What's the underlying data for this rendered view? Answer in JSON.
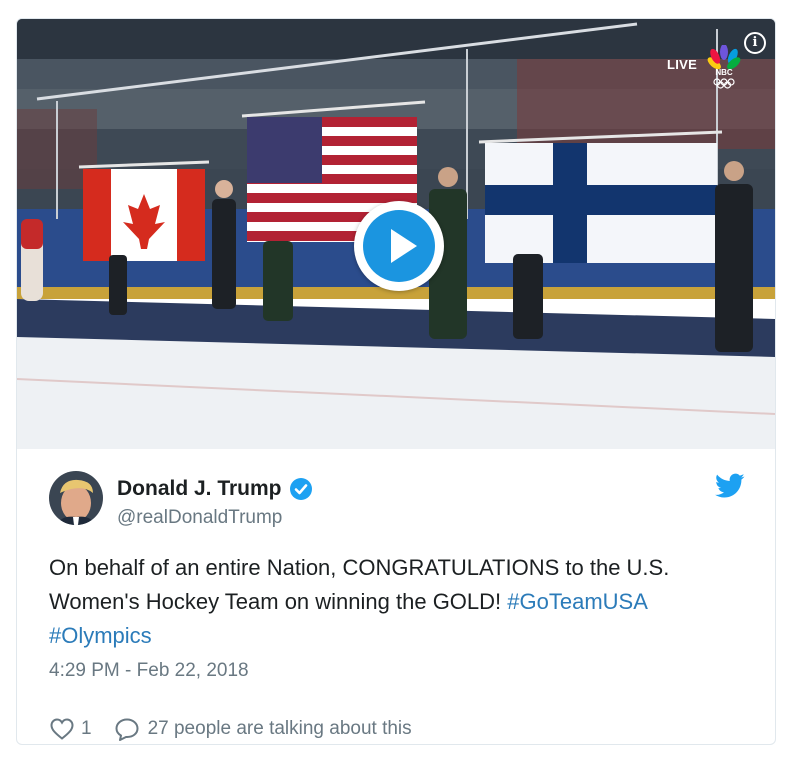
{
  "media": {
    "live_label": "LIVE",
    "network_label": "NBC",
    "info_icon": "info-icon",
    "play_icon": "play-icon",
    "colors": {
      "play": "#1b95e0",
      "ice": "#eef1f4",
      "dasher": "#2b4c8c"
    }
  },
  "tweet": {
    "name": "Donald J. Trump",
    "handle": "@realDonaldTrump",
    "verified_icon": "verified-badge-icon",
    "bird_icon": "twitter-bird-icon",
    "text_plain": "On behalf of an entire Nation, CONGRATULATIONS to the U.S. Women's Hockey Team on winning the GOLD! ",
    "hashtag1": "#GoTeamUSA",
    "hashtag2": "#Olympics",
    "timestamp": "4:29 PM - Feb 22, 2018",
    "likes": "1",
    "talking": "27 people are talking about this",
    "colors": {
      "link": "#2b7bb9",
      "muted": "#697882",
      "brand": "#1da1f2"
    }
  }
}
